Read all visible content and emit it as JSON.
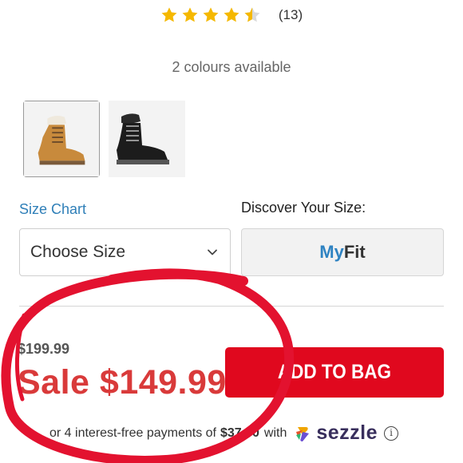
{
  "rating": {
    "stars": 4.5,
    "count": "(13)"
  },
  "colours": {
    "label": "2 colours available",
    "selected_index": 0,
    "swatch_colors": [
      "#c88a3c",
      "#1c1c1c"
    ]
  },
  "size": {
    "chart_link": "Size Chart",
    "discover_label": "Discover Your Size:",
    "select_placeholder": "Choose Size",
    "myfit_my": "My",
    "myfit_fit": "Fit"
  },
  "price": {
    "original": "$199.99",
    "sale": "Sale $149.99"
  },
  "cart": {
    "add_label": "ADD TO BAG"
  },
  "sezzle": {
    "text_before": "or 4 interest-free payments of",
    "amount": "$37.50",
    "text_after": "with",
    "brand": "sezzle",
    "info_glyph": "i"
  },
  "colors": {
    "star": "#f5b800",
    "accent_red": "#e0081e",
    "sale_red": "#d93a3a",
    "link_blue": "#2f7fb8",
    "annotation_circle": "#e3122f"
  },
  "icons": [
    "star-icon",
    "chevron-down-icon",
    "sezzle-logo-icon",
    "info-icon"
  ]
}
